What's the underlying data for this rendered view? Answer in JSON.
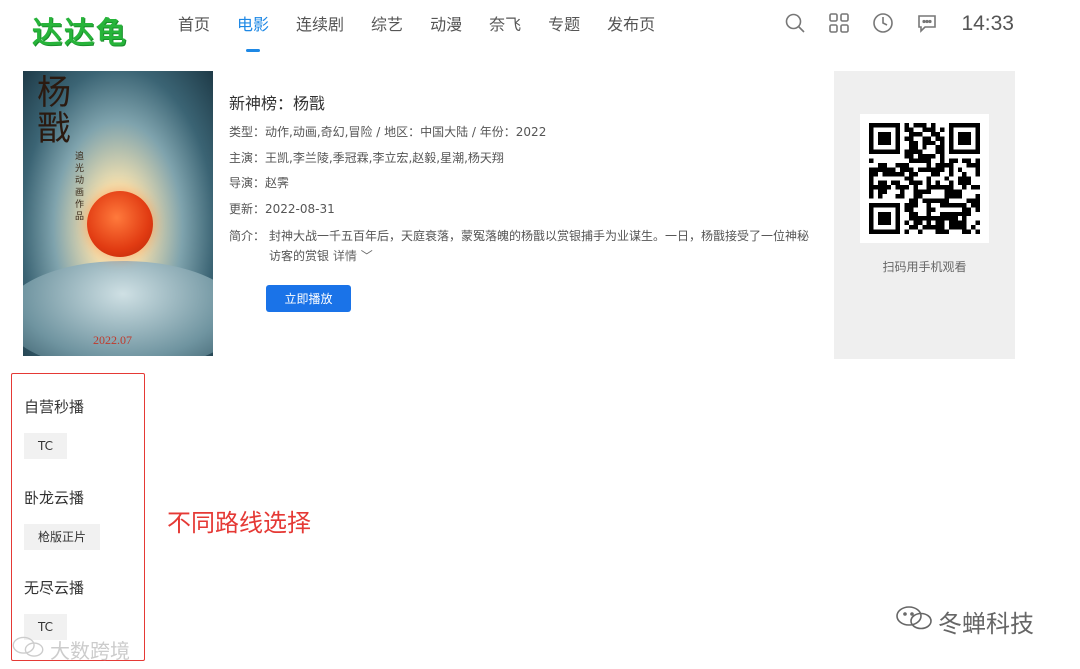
{
  "header": {
    "logo": "达达龟",
    "nav": [
      {
        "label": "首页",
        "active": false
      },
      {
        "label": "电影",
        "active": true
      },
      {
        "label": "连续剧",
        "active": false
      },
      {
        "label": "综艺",
        "active": false
      },
      {
        "label": "动漫",
        "active": false
      },
      {
        "label": "奈飞",
        "active": false
      },
      {
        "label": "专题",
        "active": false
      },
      {
        "label": "发布页",
        "active": false
      }
    ],
    "icons": [
      "search-icon",
      "grid-icon",
      "history-icon",
      "message-icon"
    ],
    "time": "14:33"
  },
  "movie": {
    "title": "新神榜：杨戬",
    "meta": "类型：动作,动画,奇幻,冒险 / 地区：中国大陆 / 年份：2022",
    "cast": "主演：王凯,李兰陵,季冠霖,李立宏,赵毅,星潮,杨天翔",
    "director": "导演：赵霁",
    "updated": "更新：2022-08-31",
    "desc_label": "简介：",
    "desc": "封神大战一千五百年后，天庭衰落，蒙冤落魄的杨戬以赏银捕手为业谋生。一日，杨戬接受了一位神秘访客的赏银",
    "desc_more": "详情",
    "play_label": "立即播放",
    "poster": {
      "title_chars": "杨戬",
      "vertical_text": "追光动画作品",
      "date": "2022.07"
    }
  },
  "qr": {
    "caption": "扫码用手机观看"
  },
  "routes": [
    {
      "name": "自营秒播",
      "tag": "TC"
    },
    {
      "name": "卧龙云播",
      "tag": "枪版正片"
    },
    {
      "name": "无尽云播",
      "tag": "TC"
    }
  ],
  "annotation": "不同路线选择",
  "watermarks": {
    "right": "冬蝉科技",
    "left": "大数跨境"
  },
  "colors": {
    "accent": "#1e88e5",
    "logo": "#27b43a",
    "button": "#1a73e8",
    "annotation": "#e53935"
  }
}
